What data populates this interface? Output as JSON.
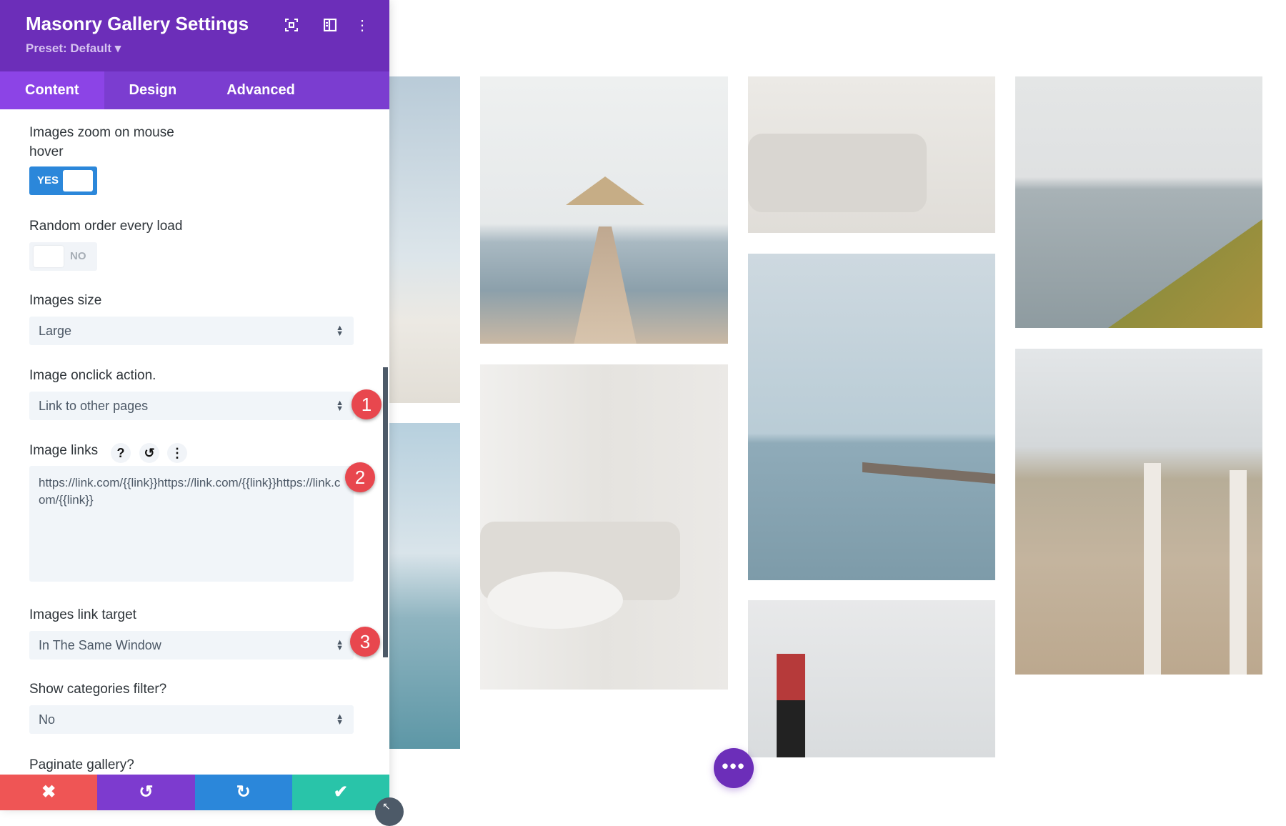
{
  "header": {
    "title": "Masonry Gallery Settings",
    "preset": "Preset: Default ▾",
    "icons": [
      "focus-icon",
      "split-view-icon",
      "more-vertical-icon"
    ]
  },
  "tabs": [
    {
      "label": "Content",
      "active": true
    },
    {
      "label": "Design"
    },
    {
      "label": "Advanced"
    }
  ],
  "fields": {
    "zoom_hover": {
      "label_line1": "Images zoom on mouse",
      "label_line2": "hover",
      "value": "YES"
    },
    "random_order": {
      "label": "Random order every load",
      "value": "NO"
    },
    "images_size": {
      "label": "Images size",
      "value": "Large"
    },
    "onclick_action": {
      "label": "Image onclick action.",
      "value": "Link to other pages",
      "badge": "1"
    },
    "image_links": {
      "label": "Image links",
      "value": "https://link.com/{{link}}https://link.com/{{link}}https://link.com/{{link}}",
      "badge": "2",
      "icons": [
        "help-icon",
        "reset-icon",
        "more-vertical-icon"
      ]
    },
    "link_target": {
      "label": "Images link target",
      "value": "In The Same Window",
      "badge": "3"
    },
    "categories_filter": {
      "label": "Show categories filter?",
      "value": "No"
    },
    "paginate": {
      "label": "Paginate gallery?"
    }
  },
  "bottom_bar": {
    "colors": {
      "cancel": "#ef5555",
      "undo": "#7d3bcf",
      "redo": "#2b87da",
      "save": "#29c4a9"
    }
  },
  "colors": {
    "header": "#6c2eb9",
    "tabs": "#7b3dd0",
    "active_tab": "#8c44e6",
    "toggle_on": "#2b87da",
    "badge": "#e8474e"
  }
}
